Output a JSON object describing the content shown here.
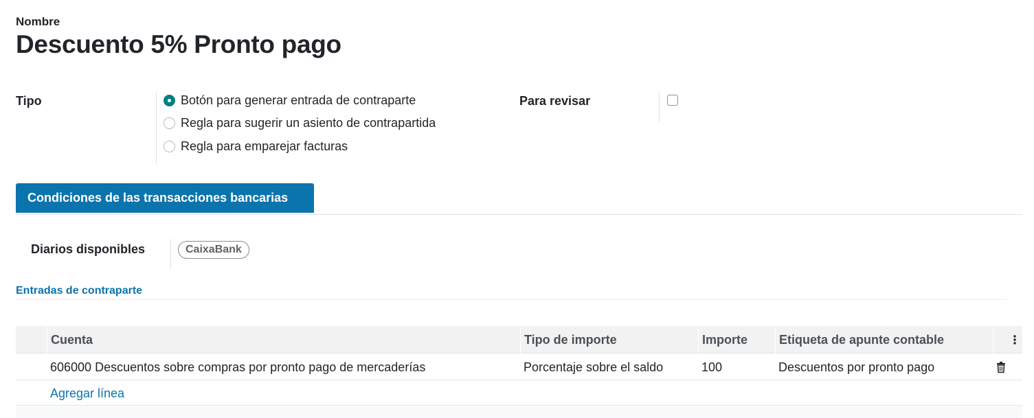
{
  "record": {
    "name_label": "Nombre",
    "title": "Descuento 5% Pronto pago"
  },
  "tipo": {
    "label": "Tipo",
    "options": [
      {
        "label": "Botón para generar entrada de contraparte",
        "selected": true
      },
      {
        "label": "Regla para sugerir un asiento de contrapartida",
        "selected": false
      },
      {
        "label": "Regla para emparejar facturas",
        "selected": false
      }
    ]
  },
  "para_revisar": {
    "label": "Para revisar",
    "checked": false
  },
  "tabs": [
    {
      "label": "Condiciones de las transacciones bancarias",
      "active": true
    }
  ],
  "diarios": {
    "label": "Diarios disponibles",
    "tags": [
      "CaixaBank"
    ]
  },
  "entradas": {
    "section_label": "Entradas de contraparte",
    "columns": [
      "Cuenta",
      "Tipo de importe",
      "Importe",
      "Etiqueta de apunte contable"
    ],
    "rows": [
      {
        "cuenta": "606000 Descuentos sobre compras por pronto pago de mercaderías",
        "tipo_importe": "Porcentaje sobre el saldo",
        "importe": "100",
        "etiqueta": "Descuentos por pronto pago"
      }
    ],
    "add_line_label": "Agregar línea"
  },
  "colors": {
    "primary": "#0b74ad",
    "radio_checked": "#017e84"
  },
  "icons": {
    "row_delete": "trash-icon",
    "column_options": "vertical-dots-icon"
  }
}
